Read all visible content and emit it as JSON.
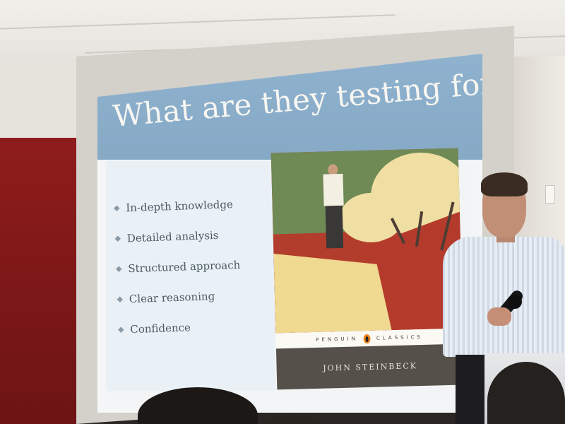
{
  "slide": {
    "title": "What are they testing for",
    "bullets": [
      "In-depth knowledge",
      "Detailed analysis",
      "Structured approach",
      "Clear reasoning",
      "Confidence"
    ]
  },
  "book_cover": {
    "band_left": "PENGUIN",
    "band_right": "CLASSICS",
    "author": "JOHN STEINBECK"
  },
  "colors": {
    "slide_header": "#8fb2cf",
    "title_text": "#f7f6f1",
    "bullet_text": "#4b5a64",
    "wall_red": "#8f1c1c",
    "book_band": "#fbf9f3",
    "book_bottom": "#555049"
  },
  "icons": {
    "bullet": "diamond-bullet-icon",
    "publisher_logo": "penguin-logo-icon"
  }
}
